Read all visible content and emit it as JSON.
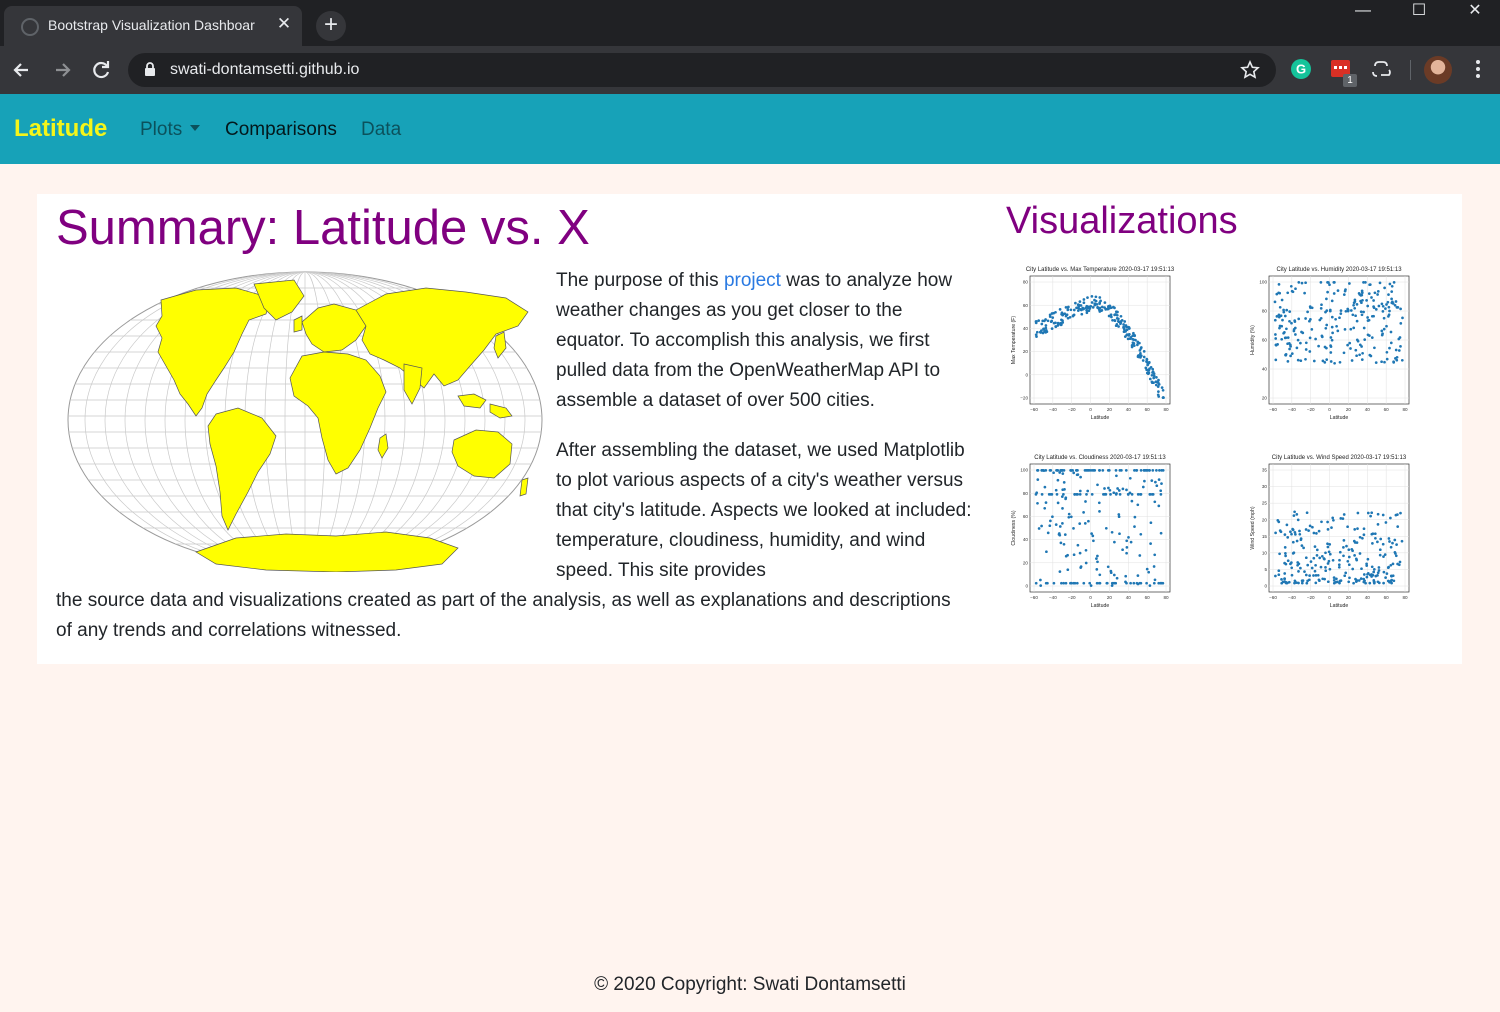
{
  "browser": {
    "tab_title": "Bootstrap Visualization Dashboar",
    "url": "swati-dontamsetti.github.io",
    "extension_badge": "1"
  },
  "navbar": {
    "brand": "Latitude",
    "links": [
      {
        "label": "Plots",
        "has_dropdown": true
      },
      {
        "label": "Comparisons",
        "active": true
      },
      {
        "label": "Data"
      }
    ],
    "bg_color": "#17a2b8",
    "brand_color": "#f5f51a"
  },
  "main": {
    "title": "Summary: Latitude vs. X",
    "p1_before_link": "The purpose of this ",
    "p1_link": "project",
    "p1_after_link": " was to analyze how weather changes as you get closer to the equator. To accomplish this analysis, we first pulled data from the OpenWeatherMap API to assemble a dataset of over 500 cities.",
    "p2_part1": "After assembling the dataset, we used Matplotlib to plot various aspects of a city's weather versus that city's latitude. Aspects we looked at included: temperature, cloudiness, humidity, and wind speed. This site provides",
    "p2_part2": "the source data and visualizations created as part of the analysis, as well as explanations and descriptions of any trends and correlations witnessed.",
    "heading_color": "#800080"
  },
  "visualizations": {
    "title": "Visualizations",
    "plots": [
      {
        "title": "City Latitude vs. Max Temperature 2020-03-17 19:51:13",
        "ylabel": "Max Temperature (F)",
        "xlabel": "Latitude",
        "yticks": [
          "80",
          "60",
          "40",
          "20",
          "0",
          "−20"
        ]
      },
      {
        "title": "City Latitude vs. Humidity 2020-03-17 19:51:13",
        "ylabel": "Humidity (%)",
        "xlabel": "Latitude",
        "yticks": [
          "100",
          "80",
          "60",
          "40",
          "20"
        ]
      },
      {
        "title": "City Latitude vs. Cloudiness 2020-03-17 19:51:13",
        "ylabel": "Cloudiness (%)",
        "xlabel": "Latitude",
        "yticks": [
          "100",
          "80",
          "60",
          "40",
          "20",
          "0"
        ]
      },
      {
        "title": "City Latitude vs. Wind Speed 2020-03-17 19:51:13",
        "ylabel": "Wind Speed (mph)",
        "xlabel": "Latitude",
        "yticks": [
          "35",
          "30",
          "25",
          "20",
          "15",
          "10",
          "5",
          "0"
        ]
      }
    ],
    "xticks": [
      "−60",
      "−40",
      "−20",
      "0",
      "20",
      "40",
      "60",
      "80"
    ],
    "point_color": "#1f77b4"
  },
  "footer": {
    "text": "© 2020 Copyright: Swati Dontamsetti"
  }
}
